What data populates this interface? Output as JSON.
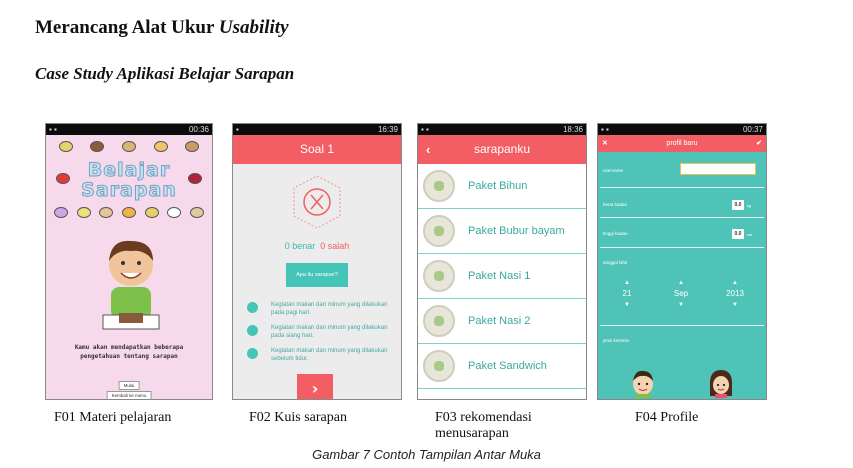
{
  "document": {
    "heading_prefix": "Merancang Alat Ukur ",
    "heading_italic": "Usability",
    "subheading": "Case Study Aplikasi Belajar Sarapan",
    "figure_caption": "Gambar 7 Contoh Tampilan Antar Muka"
  },
  "captions": {
    "f01": "F01 Materi pelajaran",
    "f02": "F02 Kuis sarapan",
    "f03_line1": "F03 rekomendasi",
    "f03_line2": "menusarapan",
    "f04": "F04 Profile"
  },
  "f01": {
    "time": "00:36",
    "title_line1": "Belajar",
    "title_line2": "Sarapan",
    "intro_text": "Kamu akan mendapatkan beberapa pengetahuan tentang sarapan",
    "btn_mulai": "Mulai",
    "btn_kembali": "Kembali ke menu"
  },
  "f02": {
    "time": "16:39",
    "title": "Soal 1",
    "benar": "0 benar",
    "salah": "0 salah",
    "question": "Apa itu sarapan?",
    "options": [
      "Kegiatan makan dan minum yang dilakukan pada pagi hari.",
      "Kegiatan makan dan minum yang dilakukan pada siang hari.",
      "Kegiatan makan dan minum yang dilakukan sebelum tidur."
    ],
    "next_glyph": "›"
  },
  "f03": {
    "time": "18:36",
    "title": "sarapanku",
    "items": [
      "Paket Bihun",
      "Paket Bubur bayam",
      "Paket Nasi 1",
      "Paket Nasi 2",
      "Paket Sandwich"
    ]
  },
  "f04": {
    "time": "00:37",
    "title": "profil baru",
    "username_label": "username",
    "berat_label": "berat badan",
    "berat_value": "0.0",
    "berat_unit": "kg",
    "tinggi_label": "tinggi badan",
    "tinggi_value": "0.0",
    "tinggi_unit": "cm",
    "tanggal_label": "tanggal lahir",
    "day": "21",
    "month": "Sep",
    "year": "2013",
    "gender_label": "jenis kelamin"
  },
  "colors": {
    "accent_red": "#f25e63",
    "accent_teal": "#45c4b8",
    "f01_bg": "#f7d9ec"
  }
}
